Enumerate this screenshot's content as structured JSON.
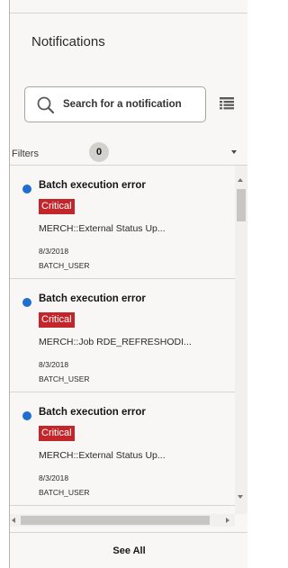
{
  "header": {
    "title": "Notifications"
  },
  "search": {
    "placeholder": "Search for a notification"
  },
  "filters": {
    "label": "Filters",
    "count": "0"
  },
  "notifications": [
    {
      "title": "Batch execution error",
      "severity": "Critical",
      "description": "MERCH::External Status Up...",
      "date": "8/3/2018",
      "user": "BATCH_USER"
    },
    {
      "title": "Batch execution error",
      "severity": "Critical",
      "description": "MERCH::Job RDE_REFRESHODI...",
      "date": "8/3/2018",
      "user": "BATCH_USER"
    },
    {
      "title": "Batch execution error",
      "severity": "Critical",
      "description": "MERCH::External Status Up...",
      "date": "8/3/2018",
      "user": "BATCH_USER"
    }
  ],
  "footer": {
    "see_all_label": "See All"
  },
  "colors": {
    "unread_dot": "#1f6fd1",
    "critical_badge": "#c2262a",
    "panel_bg": "#f8f7f6"
  },
  "icons": {
    "search": "search-icon",
    "list_view": "list-view-icon",
    "filters_toggle": "chevron-down-icon"
  }
}
